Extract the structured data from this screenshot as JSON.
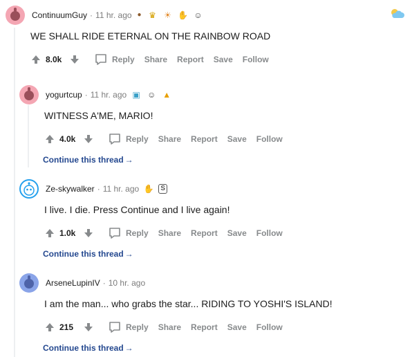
{
  "comments": [
    {
      "username": "ContinuumGuy",
      "time": "11 hr. ago",
      "body": "WE SHALL RIDE ETERNAL ON THE RAINBOW ROAD",
      "score": "8.0k",
      "awards": [
        "acorn-award",
        "crown-award",
        "sun-award",
        "hands-award",
        "face-award"
      ]
    },
    {
      "username": "yogurtcup",
      "time": "11 hr. ago",
      "body": "WITNESS A'ME, MARIO!",
      "score": "4.0k",
      "awards": [
        "picture-award",
        "face-award",
        "arrow-up-award"
      ],
      "continue": "Continue this thread"
    },
    {
      "username": "Ze-skywalker",
      "time": "11 hr. ago",
      "body": "I live. I die. Press Continue and I live again!",
      "score": "1.0k",
      "awards": [
        "hands-award",
        "silver-s-award"
      ],
      "continue": "Continue this thread"
    },
    {
      "username": "ArseneLupinIV",
      "time": "10 hr. ago",
      "body": "I am the man... who grabs the star... RIDING TO YOSHI'S ISLAND!",
      "score": "215",
      "awards": [],
      "continue": "Continue this thread"
    }
  ],
  "actions": {
    "reply": "Reply",
    "share": "Share",
    "report": "Report",
    "save": "Save",
    "follow": "Follow"
  },
  "colors": {
    "action_gray": "#878a8c",
    "link_blue": "#24488f",
    "thread_line": "#edeff1"
  }
}
